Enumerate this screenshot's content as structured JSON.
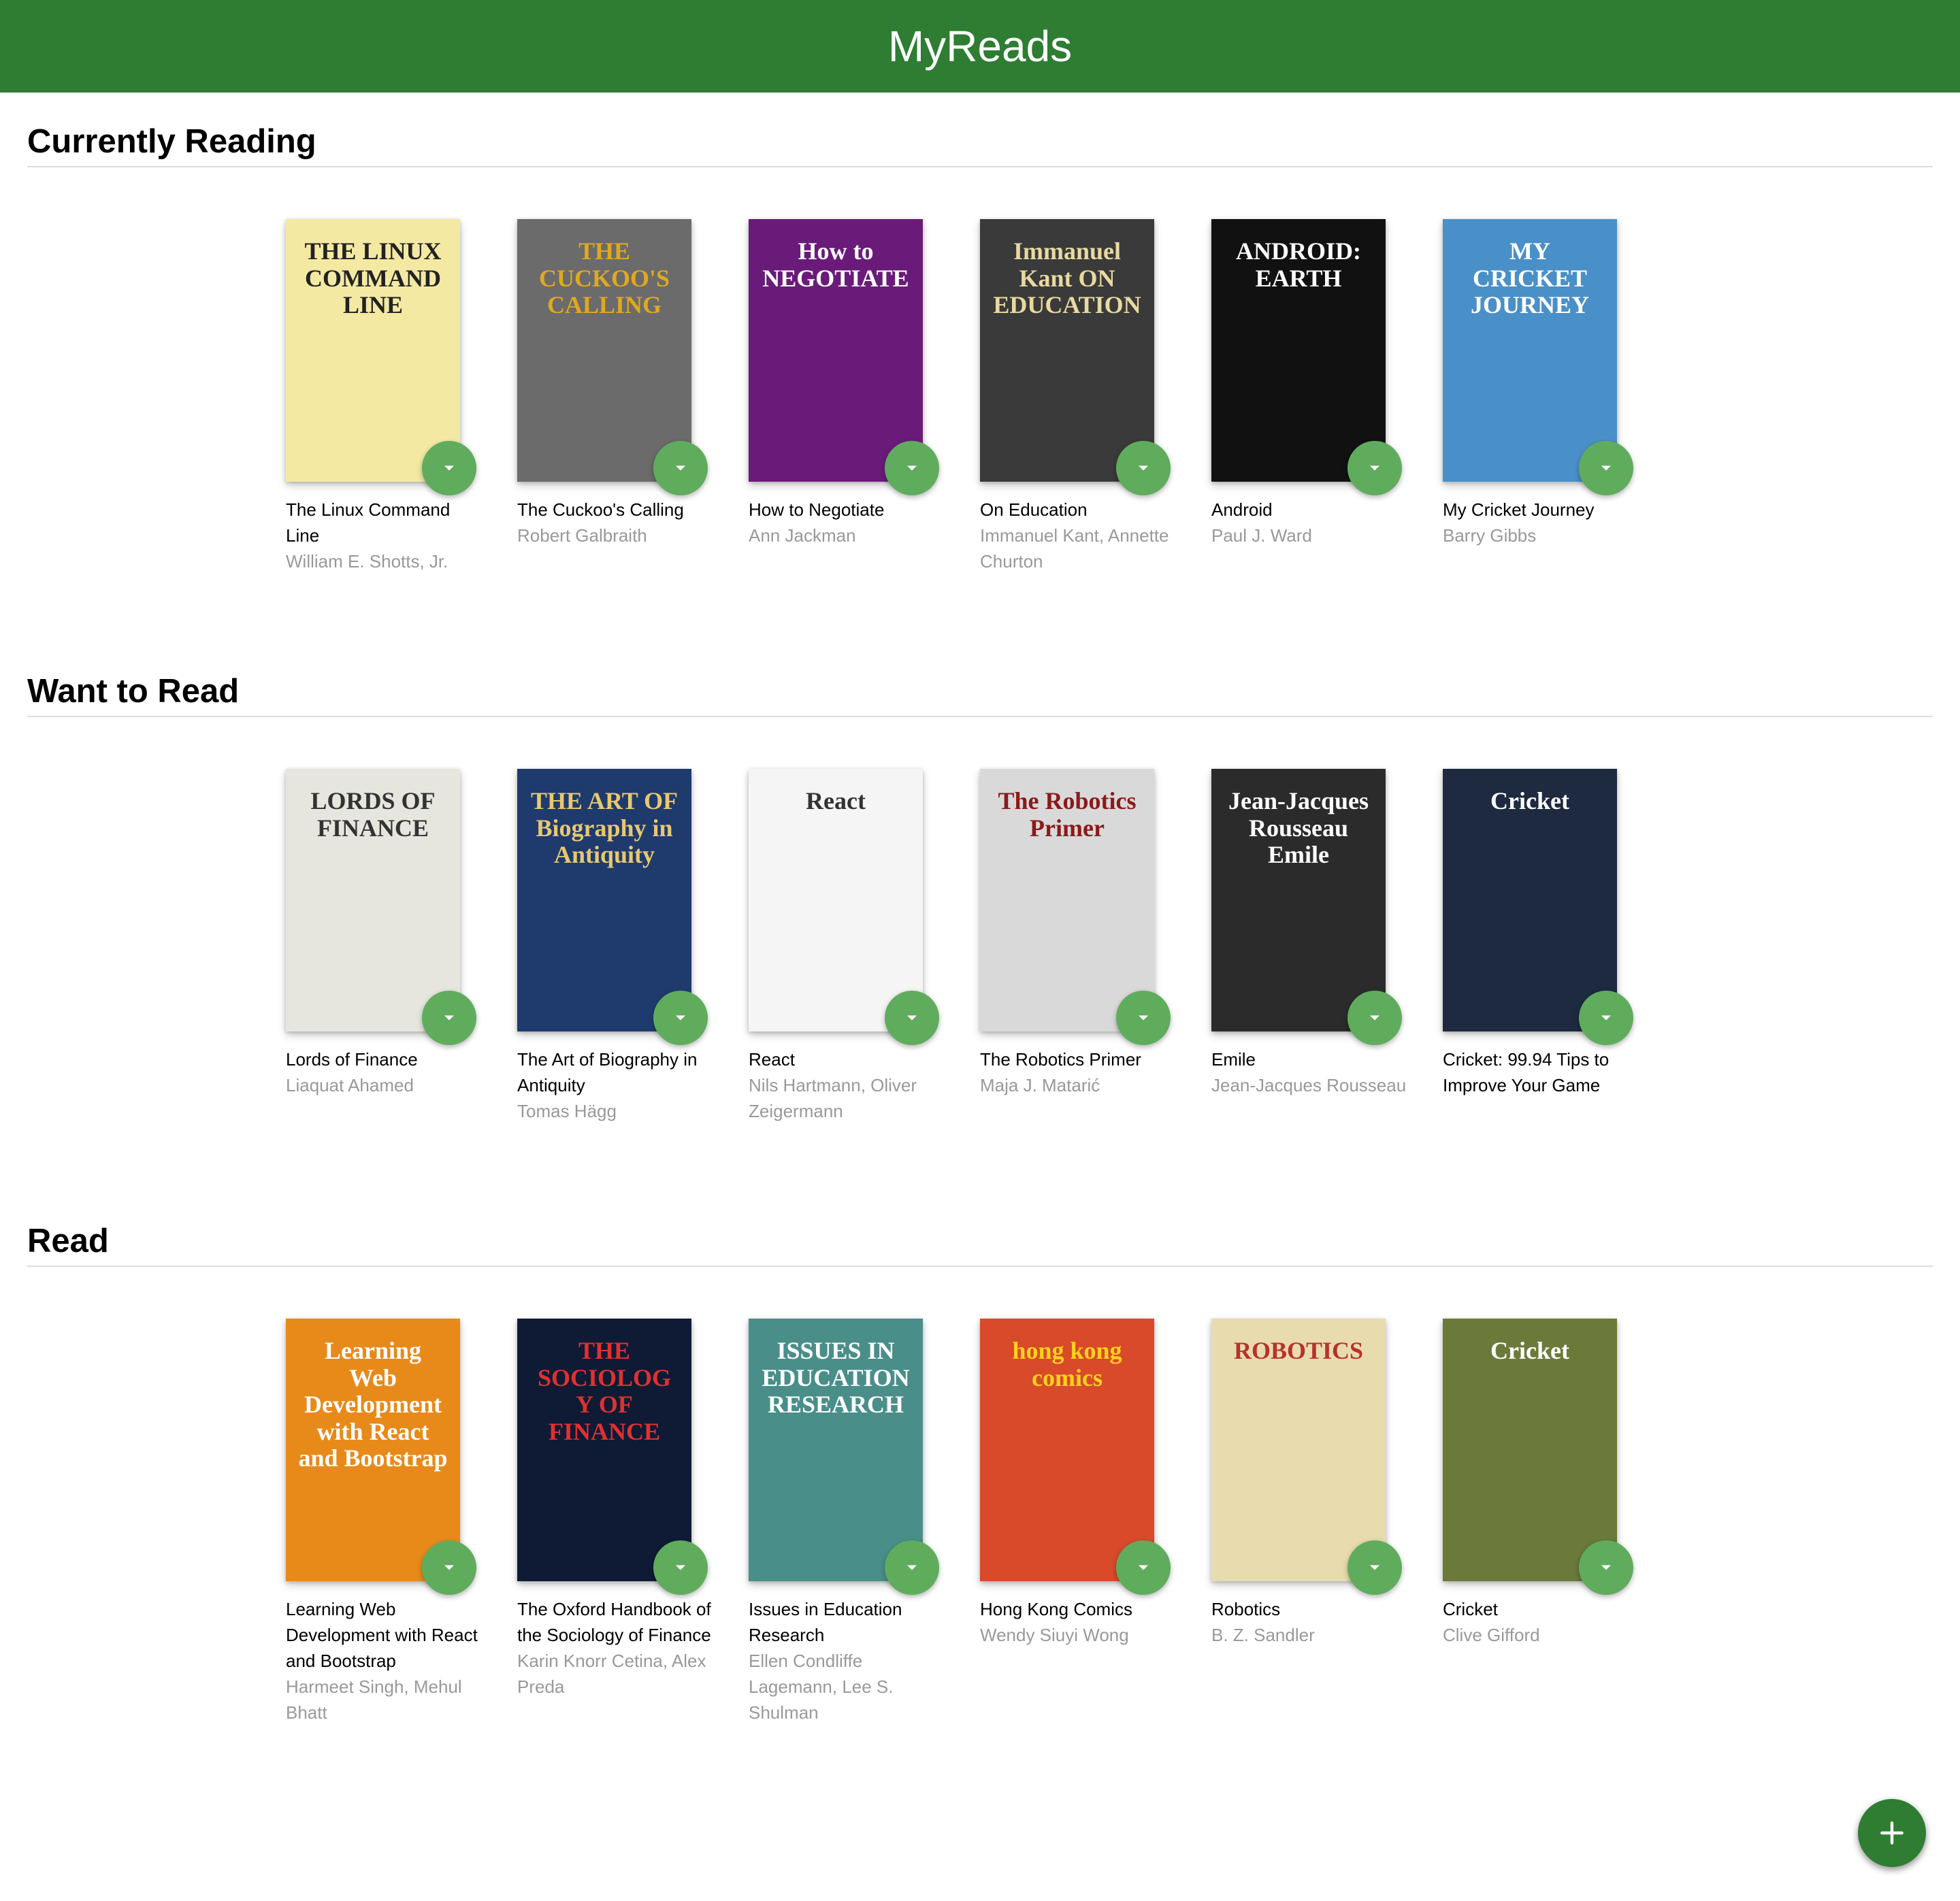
{
  "header": {
    "title": "MyReads"
  },
  "shelves": [
    {
      "title": "Currently Reading",
      "books": [
        {
          "title": "The Linux Command Line",
          "authors": "William E. Shotts, Jr.",
          "cover_text": "THE LINUX COMMAND LINE",
          "cover_bg": "#f4e9a3",
          "cover_fg": "#222222"
        },
        {
          "title": "The Cuckoo's Calling",
          "authors": "Robert Galbraith",
          "cover_text": "THE CUCKOO'S CALLING",
          "cover_bg": "#6b6b6b",
          "cover_fg": "#e0a820"
        },
        {
          "title": "How to Negotiate",
          "authors": "Ann Jackman",
          "cover_text": "How to NEGOTIATE",
          "cover_bg": "#6a1b7a",
          "cover_fg": "#ffffff"
        },
        {
          "title": "On Education",
          "authors": "Immanuel Kant, Annette Churton",
          "cover_text": "Immanuel Kant ON EDUCATION",
          "cover_bg": "#3a3a3a",
          "cover_fg": "#e8d9a0"
        },
        {
          "title": "Android",
          "authors": "Paul J. Ward",
          "cover_text": "ANDROID: EARTH",
          "cover_bg": "#111111",
          "cover_fg": "#ffffff"
        },
        {
          "title": "My Cricket Journey",
          "authors": "Barry Gibbs",
          "cover_text": "MY CRICKET JOURNEY",
          "cover_bg": "#4a90c8",
          "cover_fg": "#ffffff"
        }
      ]
    },
    {
      "title": "Want to Read",
      "books": [
        {
          "title": "Lords of Finance",
          "authors": "Liaquat Ahamed",
          "cover_text": "LORDS OF FINANCE",
          "cover_bg": "#e6e6df",
          "cover_fg": "#333333"
        },
        {
          "title": "The Art of Biography in Antiquity",
          "authors": "Tomas Hägg",
          "cover_text": "THE ART OF Biography in Antiquity",
          "cover_bg": "#1f3b6e",
          "cover_fg": "#e8c870"
        },
        {
          "title": "React",
          "authors": "Nils Hartmann, Oliver Zeigermann",
          "cover_text": "React",
          "cover_bg": "#f5f5f5",
          "cover_fg": "#333333"
        },
        {
          "title": "The Robotics Primer",
          "authors": "Maja J. Matarić",
          "cover_text": "The Robotics Primer",
          "cover_bg": "#d9d9d9",
          "cover_fg": "#8b1a1a"
        },
        {
          "title": "Emile",
          "authors": "Jean-Jacques Rousseau",
          "cover_text": "Jean-Jacques Rousseau Emile",
          "cover_bg": "#2b2b2b",
          "cover_fg": "#ffffff"
        },
        {
          "title": "Cricket: 99.94 Tips to Improve Your Game",
          "authors": "",
          "cover_text": "Cricket",
          "cover_bg": "#1d2a40",
          "cover_fg": "#ffffff"
        }
      ]
    },
    {
      "title": "Read",
      "books": [
        {
          "title": "Learning Web Development with React and Bootstrap",
          "authors": "Harmeet Singh, Mehul Bhatt",
          "cover_text": "Learning Web Development with React and Bootstrap",
          "cover_bg": "#e88a1a",
          "cover_fg": "#ffffff"
        },
        {
          "title": "The Oxford Handbook of the Sociology of Finance",
          "authors": "Karin Knorr Cetina, Alex Preda",
          "cover_text": "THE SOCIOLOGY OF FINANCE",
          "cover_bg": "#0f1a35",
          "cover_fg": "#e23030"
        },
        {
          "title": "Issues in Education Research",
          "authors": "Ellen Condliffe Lagemann, Lee S. Shulman",
          "cover_text": "ISSUES IN EDUCATION RESEARCH",
          "cover_bg": "#4a8e8a",
          "cover_fg": "#ffffff"
        },
        {
          "title": "Hong Kong Comics",
          "authors": "Wendy Siuyi Wong",
          "cover_text": "hong kong comics",
          "cover_bg": "#d84a2a",
          "cover_fg": "#ffd21a"
        },
        {
          "title": "Robotics",
          "authors": "B. Z. Sandler",
          "cover_text": "ROBOTICS",
          "cover_bg": "#e8dcae",
          "cover_fg": "#b8322a"
        },
        {
          "title": "Cricket",
          "authors": "Clive Gifford",
          "cover_text": "Cricket",
          "cover_bg": "#6b7a3a",
          "cover_fg": "#ffffff"
        }
      ]
    }
  ]
}
